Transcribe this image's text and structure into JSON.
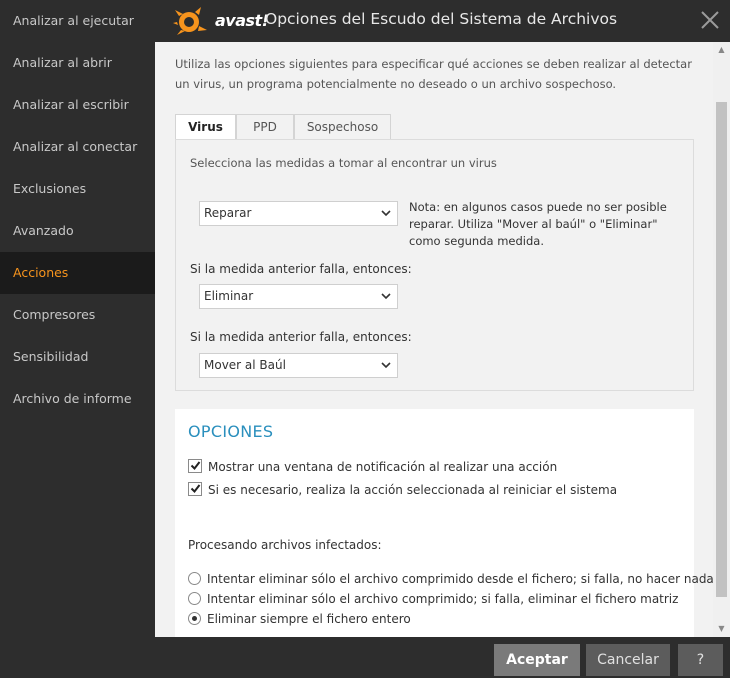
{
  "sidebar": {
    "items": [
      {
        "label": "Analizar al ejecutar"
      },
      {
        "label": "Analizar al abrir"
      },
      {
        "label": "Analizar al escribir"
      },
      {
        "label": "Analizar al conectar"
      },
      {
        "label": "Exclusiones"
      },
      {
        "label": "Avanzado"
      },
      {
        "label": "Acciones"
      },
      {
        "label": "Compresores"
      },
      {
        "label": "Sensibilidad"
      },
      {
        "label": "Archivo de informe"
      }
    ],
    "active_index": 6
  },
  "titlebar": {
    "brand": "avast!",
    "title": "Opciones del Escudo del Sistema de Archivos"
  },
  "intro_text": "Utiliza las opciones siguientes para especificar qué acciones se deben realizar al detectar un virus, un programa potencialmente no deseado o un archivo sospechoso.",
  "tabs": [
    {
      "label": "Virus",
      "active": true
    },
    {
      "label": "PPD",
      "active": false
    },
    {
      "label": "Sospechoso",
      "active": false
    }
  ],
  "panel": {
    "heading": "Selecciona las medidas a tomar al encontrar un virus",
    "action1": "Reparar",
    "note": "Nota: en algunos casos puede no ser posible reparar. Utiliza \"Mover al baúl\" o \"Eliminar\" como segunda medida.",
    "fallback_label_1": "Si la medida anterior falla, entonces:",
    "action2": "Eliminar",
    "fallback_label_2": "Si la medida anterior falla, entonces:",
    "action3": "Mover al Baúl"
  },
  "options": {
    "title": "OPCIONES",
    "checkboxes": [
      {
        "label": "Mostrar una ventana de notificación al realizar una acción",
        "checked": true
      },
      {
        "label": "Si es necesario, realiza la acción seleccionada al reiniciar el sistema",
        "checked": true
      }
    ],
    "processing_label": "Procesando archivos infectados:",
    "radios": [
      {
        "label": "Intentar eliminar sólo el archivo comprimido desde el fichero; si falla, no hacer nada",
        "selected": false
      },
      {
        "label": "Intentar eliminar sólo el archivo comprimido; si falla, eliminar el fichero matriz",
        "selected": false
      },
      {
        "label": "Eliminar siempre el fichero entero",
        "selected": true
      }
    ]
  },
  "footer": {
    "accept": "Aceptar",
    "cancel": "Cancelar",
    "help": "?"
  },
  "colors": {
    "accent_orange": "#f7941d",
    "options_title_blue": "#2a8fbd",
    "dark_bg": "#2d2d2d"
  }
}
